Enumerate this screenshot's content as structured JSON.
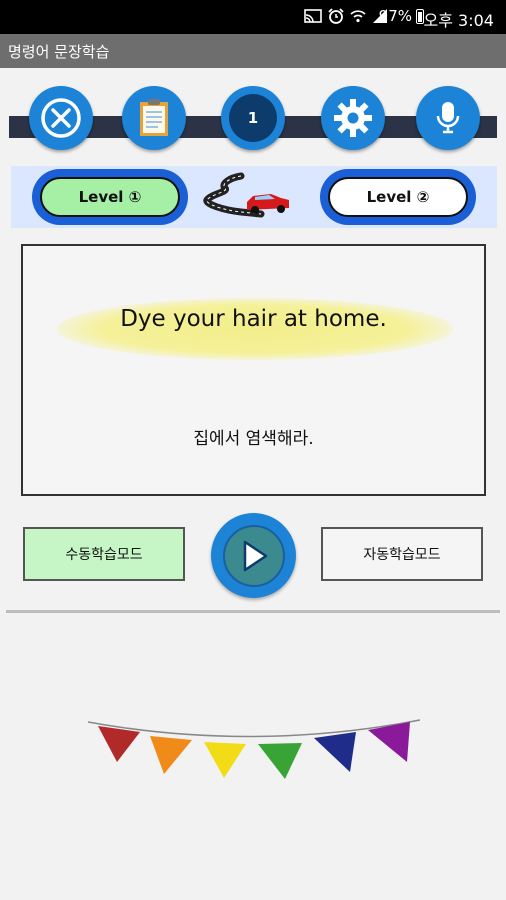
{
  "status_bar": {
    "battery": "97%",
    "time": "오후 3:04",
    "icons": [
      "cast-icon",
      "alarm-icon",
      "wifi-icon",
      "signal-icon",
      "battery-icon"
    ]
  },
  "app_bar": {
    "title": "명령어 문장학습"
  },
  "toolbar": {
    "buttons": [
      {
        "name": "close",
        "icon": "close-circle-icon"
      },
      {
        "name": "list",
        "icon": "clipboard-icon"
      },
      {
        "name": "count",
        "label": "1"
      },
      {
        "name": "settings",
        "icon": "gear-icon"
      },
      {
        "name": "voice",
        "icon": "microphone-icon"
      }
    ]
  },
  "levels": {
    "level1": {
      "label": "Level ①",
      "selected": true
    },
    "level2": {
      "label": "Level ②",
      "selected": false
    },
    "road_icon": "car-road-icon"
  },
  "sentence": {
    "english": "Dye your hair at home.",
    "korean": "집에서 염색해라."
  },
  "modes": {
    "manual": {
      "label": "수동학습모드",
      "selected": true
    },
    "auto": {
      "label": "자동학습모드",
      "selected": false
    }
  },
  "player": {
    "icon": "play-icon"
  },
  "decoration": {
    "name": "bunting-flags",
    "colors": [
      "#b02a2a",
      "#f08a18",
      "#f2dc18",
      "#3aa336",
      "#1f2c8a",
      "#8a1a9a"
    ]
  },
  "colors": {
    "accent": "#1c83d6",
    "selected_pill": "#a6f0a6",
    "mode_selected": "#c6f5c6"
  }
}
